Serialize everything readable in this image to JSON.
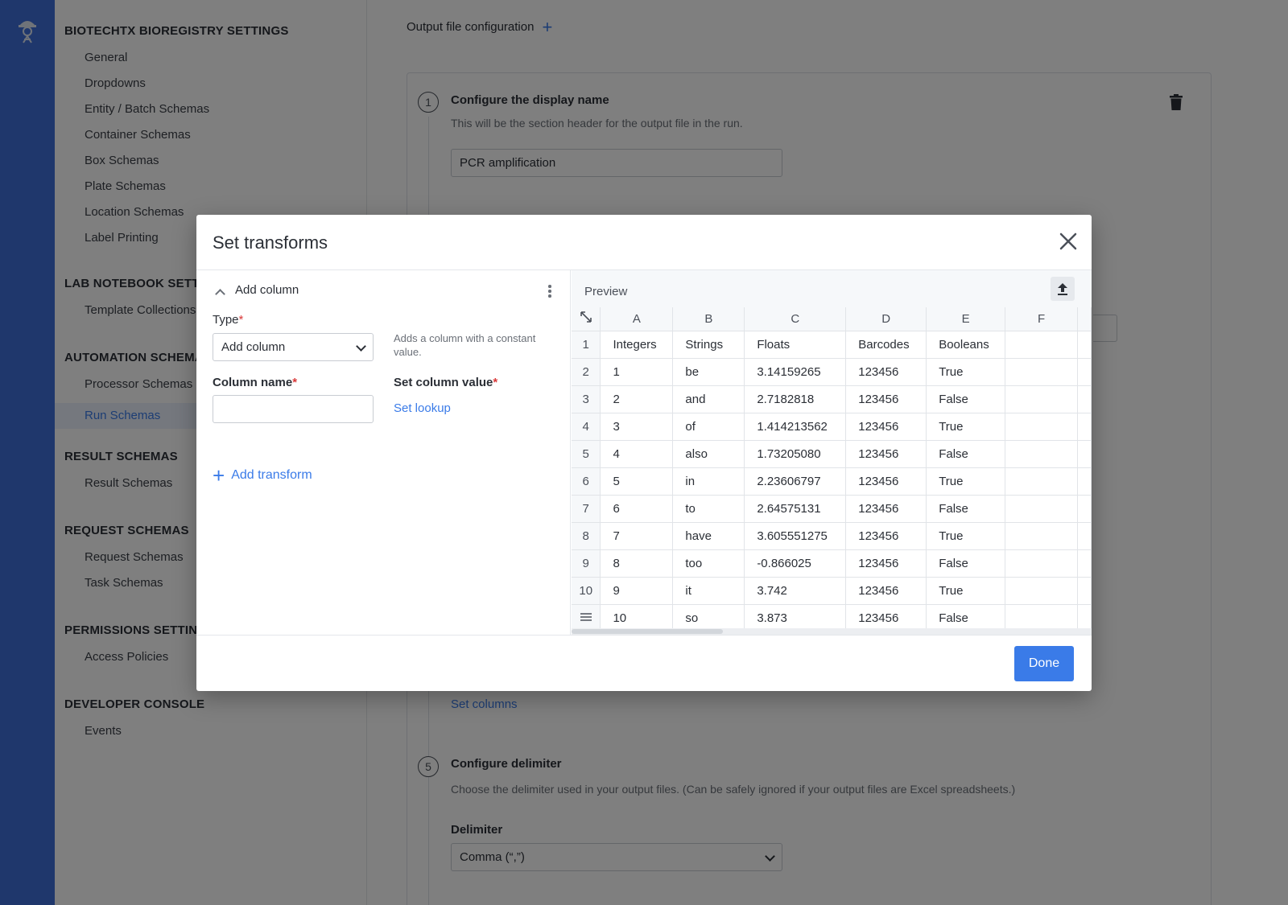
{
  "settings_nav": {
    "sections": [
      {
        "title": "BIOTECHTX BIOREGISTRY SETTINGS",
        "items": [
          "General",
          "Dropdowns",
          "Entity / Batch Schemas",
          "Container Schemas",
          "Box Schemas",
          "Plate Schemas",
          "Location Schemas",
          "Label Printing"
        ]
      },
      {
        "title": "LAB NOTEBOOK SETTINGS",
        "items": [
          "Template Collections"
        ]
      },
      {
        "title": "AUTOMATION SCHEMAS",
        "items": [
          "Processor Schemas",
          "Run Schemas"
        ]
      },
      {
        "title": "RESULT SCHEMAS",
        "items": [
          "Result Schemas"
        ]
      },
      {
        "title": "REQUEST SCHEMAS",
        "items": [
          "Request Schemas",
          "Task Schemas"
        ]
      },
      {
        "title": "PERMISSIONS SETTINGS",
        "items": [
          "Access Policies"
        ]
      },
      {
        "title": "DEVELOPER CONSOLE",
        "items": [
          "Events"
        ]
      }
    ],
    "active_item": "Run Schemas"
  },
  "main": {
    "header": "Output file configuration",
    "step1": {
      "number": "1",
      "title": "Configure the display name",
      "description": "This will be the section header for the output file in the run.",
      "value": "PCR amplification"
    },
    "set_columns_link": "Set columns",
    "step5": {
      "number": "5",
      "title": "Configure delimiter",
      "description": "Choose the delimiter used in your output files. (Can be safely ignored if your output files are Excel spreadsheets.)",
      "delimiter_label": "Delimiter",
      "delimiter_value": "Comma (“,”)"
    }
  },
  "modal": {
    "title": "Set transforms",
    "transform": {
      "header": "Add column",
      "type_label": "Type",
      "type_value": "Add column",
      "type_help": "Adds a column with a constant value.",
      "column_name_label": "Column name",
      "column_name_value": "",
      "set_value_label": "Set column value",
      "set_lookup_link": "Set lookup"
    },
    "add_transform_label": "Add transform",
    "preview": {
      "label": "Preview",
      "column_letters": [
        "A",
        "B",
        "C",
        "D",
        "E",
        "F"
      ],
      "row_numbers": [
        "1",
        "2",
        "3",
        "4",
        "5",
        "6",
        "7",
        "8",
        "9",
        "10"
      ],
      "rows": [
        [
          "Integers",
          "Strings",
          "Floats",
          "Barcodes",
          "Booleans",
          ""
        ],
        [
          "1",
          "be",
          "3.14159265",
          "123456",
          "True",
          ""
        ],
        [
          "2",
          "and",
          "2.7182818",
          "123456",
          "False",
          ""
        ],
        [
          "3",
          "of",
          "1.414213562",
          "123456",
          "True",
          ""
        ],
        [
          "4",
          "also",
          "1.73205080",
          "123456",
          "False",
          ""
        ],
        [
          "5",
          "in",
          "2.23606797",
          "123456",
          "True",
          ""
        ],
        [
          "6",
          "to",
          "2.64575131",
          "123456",
          "False",
          ""
        ],
        [
          "7",
          "have",
          "3.605551275",
          "123456",
          "True",
          ""
        ],
        [
          "8",
          "too",
          "-0.866025",
          "123456",
          "False",
          ""
        ],
        [
          "9",
          "it",
          "3.742",
          "123456",
          "True",
          ""
        ],
        [
          "10",
          "so",
          "3.873",
          "123456",
          "False",
          ""
        ]
      ]
    },
    "done_label": "Done"
  },
  "colors": {
    "accent": "#3a7be8",
    "rail": "#3f6fd9",
    "required": "#d93a3a"
  }
}
